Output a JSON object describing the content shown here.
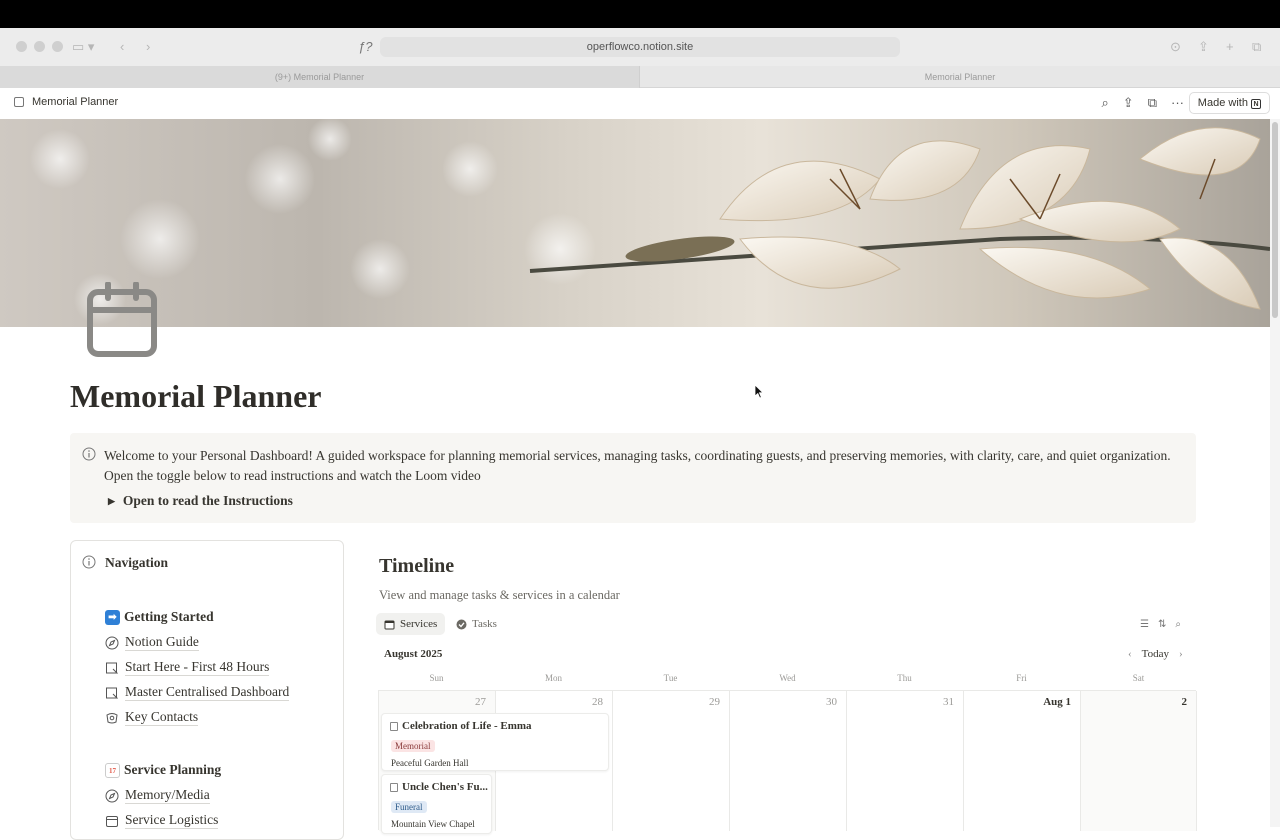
{
  "browser": {
    "url": "operflowco.notion.site",
    "tabs": [
      {
        "label": "(9+) Memorial Planner"
      },
      {
        "label": "Memorial Planner"
      }
    ]
  },
  "notion_bar": {
    "page_title": "Memorial Planner",
    "made_with_label": "Made with"
  },
  "page": {
    "title": "Memorial Planner",
    "callout_line1": "Welcome to your Personal Dashboard!  A guided workspace for planning memorial services, managing tasks, coordinating guests, and preserving memories, with clarity, care, and quiet organization.",
    "callout_line2": "Open the toggle below to read instructions and watch the Loom video",
    "toggle_label": "Open to read the Instructions"
  },
  "navigation": {
    "title": "Navigation",
    "sections": [
      {
        "title": "Getting Started",
        "emoji_color": "#2f80d6",
        "emoji_glyph": "➡",
        "items": [
          "Notion Guide",
          "Start Here - First 48 Hours",
          "Master Centralised Dashboard",
          "Key Contacts"
        ]
      },
      {
        "title": "Service Planning",
        "emoji_color": "#e25c4d",
        "emoji_glyph": "17",
        "items": [
          "Memory/Media",
          "Service Logistics"
        ]
      }
    ]
  },
  "timeline": {
    "title": "Timeline",
    "subtitle": "View and manage tasks & services in a calendar",
    "views": [
      "Services",
      "Tasks"
    ],
    "month": "August 2025",
    "today_label": "Today",
    "weekdays": [
      "Sun",
      "Mon",
      "Tue",
      "Wed",
      "Thu",
      "Fri",
      "Sat"
    ],
    "days": [
      "27",
      "28",
      "29",
      "30",
      "31",
      "Aug 1",
      "2"
    ],
    "events": [
      {
        "title": "Celebration of Life - Emma",
        "tag": "Memorial",
        "tag_bg": "#fbe4e4",
        "tag_color": "#8a3a3a",
        "location": "Peaceful Garden Hall"
      },
      {
        "title": "Uncle Chen's Fu...",
        "tag": "Funeral",
        "tag_bg": "#dfe9f5",
        "tag_color": "#2e5b8a",
        "location": "Mountain View Chapel"
      }
    ]
  }
}
